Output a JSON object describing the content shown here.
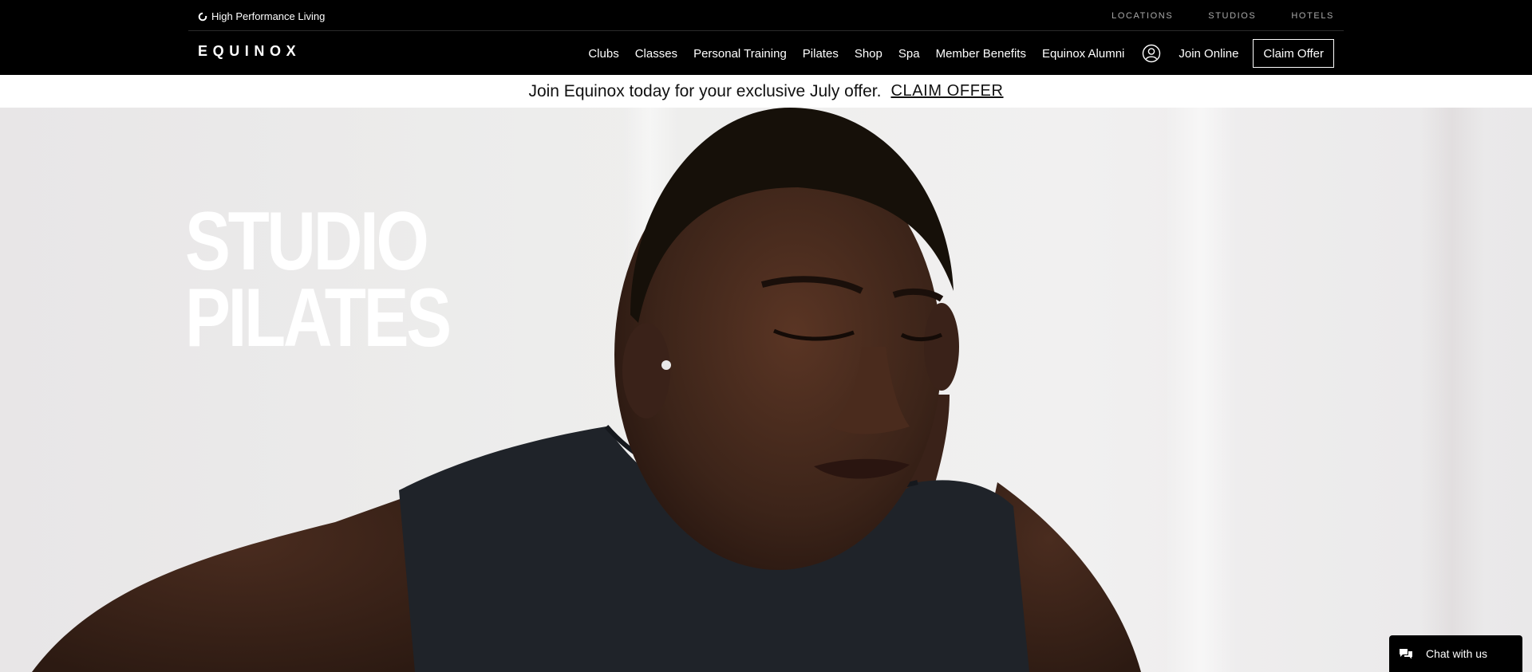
{
  "utility_bar": {
    "tagline": "High Performance Living",
    "links": [
      "LOCATIONS",
      "STUDIOS",
      "HOTELS"
    ]
  },
  "nav": {
    "logo": "EQUINOX",
    "items": [
      "Clubs",
      "Classes",
      "Personal Training",
      "Pilates",
      "Shop",
      "Spa",
      "Member Benefits",
      "Equinox Alumni"
    ],
    "account_icon": "user-circle-icon",
    "join_online": "Join Online",
    "claim_offer": "Claim Offer"
  },
  "promo": {
    "text": "Join Equinox today for your exclusive July offer.",
    "link": "CLAIM OFFER"
  },
  "hero": {
    "title_line1": "STUDIO",
    "title_line2": "PILATES"
  },
  "chat": {
    "label": "Chat with us",
    "icon": "chat-bubbles-icon"
  },
  "colors": {
    "nav_bg": "#000000",
    "promo_bg": "#ffffff",
    "hero_bg": "#ececeb",
    "skin": "#3a2419",
    "tank": "#1f2329"
  }
}
